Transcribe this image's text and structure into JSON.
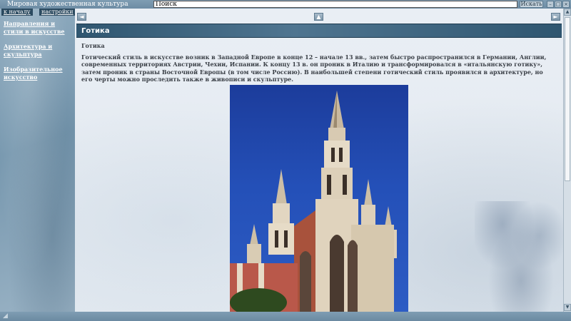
{
  "window": {
    "title": "Мировая художественная культура"
  },
  "search": {
    "value": "Поиск",
    "button_label": "Искать",
    "win_buttons": [
      "–",
      "□",
      "×"
    ]
  },
  "sidebar": {
    "tabs": [
      "к началу",
      "настройки"
    ],
    "links": [
      "Направления и стили в искусстве",
      "Архитектура и скульптура",
      "Изобразительное искусство"
    ]
  },
  "nav": {
    "prev_icon": "left-arrow-icon",
    "up_icon": "up-arrow-icon",
    "next_icon": "right-arrow-icon"
  },
  "article": {
    "heading": "Готика",
    "subtitle": "Готика",
    "text": "Готический стиль в искусстве возник в Западной Европе в конце 12 – начале 13 вв., затем быстро распространился в Германии, Англии, современных территориях Австрии, Чехии, Испании. К концу 13 в. он проник в Италию и трансформировался в «итальянскую готику», затем проник в страны Восточной Европы (в том числе Россию). В наибольшей степени готический стиль проявился в архитектуре, но его черты можно проследить также в живописи и скульптуре."
  },
  "colors": {
    "heading_bar": "#2f5670",
    "sidebar": "#7697ae",
    "sky": "#2450b8"
  }
}
